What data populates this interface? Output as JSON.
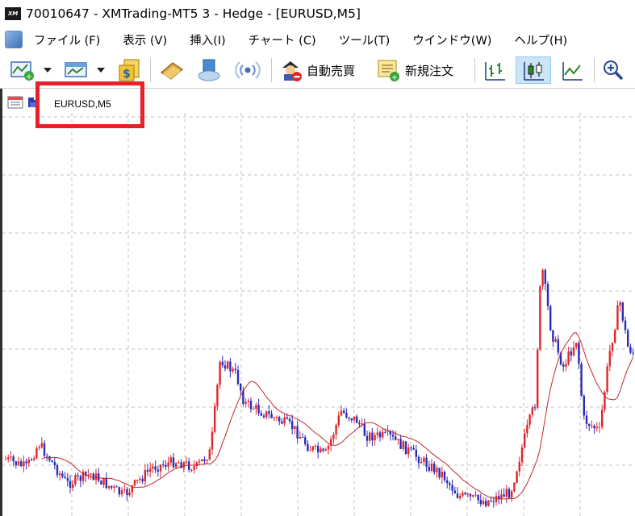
{
  "window": {
    "title": "70010647 - XMTrading-MT5 3 - Hedge - [EURUSD,M5]",
    "logo_text": "XM"
  },
  "menu": {
    "items": [
      {
        "label": "ファイル (F)"
      },
      {
        "label": "表示 (V)"
      },
      {
        "label": "挿入(I)"
      },
      {
        "label": "チャート (C)"
      },
      {
        "label": "ツール(T)"
      },
      {
        "label": "ウインドウ(W)"
      },
      {
        "label": "ヘルプ(H)"
      }
    ]
  },
  "toolbar": {
    "auto_trade_label": "自動売買",
    "new_order_label": "新規注文"
  },
  "chart": {
    "symbol_label": "EURUSD,M5",
    "colors": {
      "bull": "#e0262b",
      "bear": "#2b2bb8",
      "ma": "#c4262b",
      "grid": "#c0c0c0",
      "highlight": "#e8202a"
    }
  }
}
